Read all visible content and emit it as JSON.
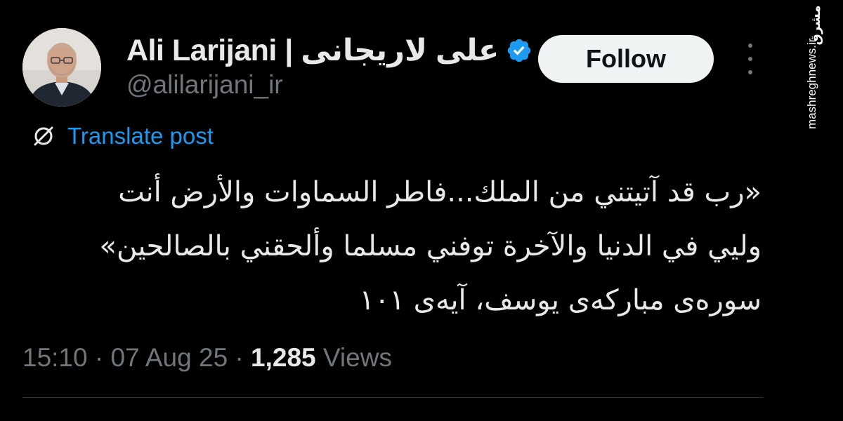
{
  "author": {
    "display_name": "Ali Larijani | علی لاریجانی",
    "handle": "@alilarijani_ir",
    "verified": true
  },
  "actions": {
    "follow_label": "Follow"
  },
  "watermark": {
    "logo_text": "مشرق",
    "url": "mashreghnews.ir"
  },
  "translate": {
    "label": "Translate post"
  },
  "post": {
    "lines": [
      "«رب قد آتيتني من الملك...فاطر السماوات والأرض أنت",
      "وليي في الدنيا والآخرة توفني مسلما وألحقني بالصالحين»",
      "سوره‌ی مبارکه‌ی یوسف، آیه‌ی ۱۰۱"
    ]
  },
  "meta": {
    "time": "15:10",
    "separator": " · ",
    "date": "07 Aug 25",
    "views_count": "1,285",
    "views_label": "Views"
  },
  "colors": {
    "background": "#000000",
    "text_primary": "#e7e9ea",
    "text_secondary": "#71767b",
    "link_blue": "#1d9bf0",
    "verified_blue": "#1d9bf0",
    "follow_bg": "#eff3f4",
    "divider": "#2f3336"
  },
  "icons": {
    "verified": "verified-badge-icon",
    "translate": "translate-icon",
    "more": "more-dots-icon"
  }
}
